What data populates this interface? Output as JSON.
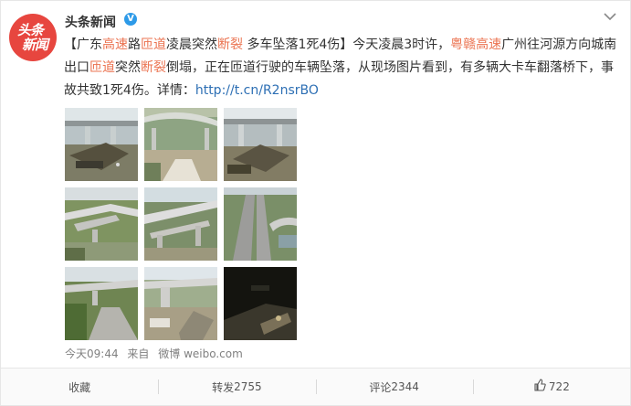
{
  "author": {
    "name": "头条新闻",
    "avatar_line1": "头条",
    "avatar_line2": "新闻",
    "verified_mark": "V"
  },
  "post": {
    "segments": [
      {
        "t": "【广东"
      },
      {
        "t": "高速",
        "c": "hl"
      },
      {
        "t": "路"
      },
      {
        "t": "匝道",
        "c": "hl"
      },
      {
        "t": "凌晨突然"
      },
      {
        "t": "断裂",
        "c": "hl"
      },
      {
        "t": " 多车坠落1死4伤】今天凌晨3时许，"
      },
      {
        "t": "粤赣高速",
        "c": "link"
      },
      {
        "t": "广州往河源方向城南出口"
      },
      {
        "t": "匝道",
        "c": "hl"
      },
      {
        "t": "突然"
      },
      {
        "t": "断裂",
        "c": "hl"
      },
      {
        "t": "倒塌，正在匝道行驶的车辆坠落，从现场图片看到，有多辆大卡车翻落桥下，事故共致1死4伤。详情："
      },
      {
        "t": "http://t.cn/R2nsrBO",
        "c": "url"
      }
    ],
    "photos": [
      "photo-bridge-wreck-1",
      "photo-collapsed-ramp-aerial",
      "photo-bridge-wreck-2",
      "photo-collapsed-span-1",
      "photo-collapsed-span-2",
      "photo-highway-aerial",
      "photo-bridge-river-left",
      "photo-bridge-pier-debris",
      "photo-night-scene"
    ]
  },
  "meta": {
    "time": "今天09:44",
    "from_label": "来自",
    "source": "微博 weibo.com"
  },
  "actions": {
    "collect": "收藏",
    "repost_label": "转发",
    "repost_count": "2755",
    "comment_label": "评论",
    "comment_count": "2344",
    "like_count": "722"
  },
  "colors": {
    "accent": "#eb7350",
    "link": "#2d6fb4",
    "avatar": "#e7463f",
    "verified": "#2d9ae8"
  },
  "icons": {
    "more": "chevron-down-icon",
    "like": "thumbs-up-icon"
  }
}
